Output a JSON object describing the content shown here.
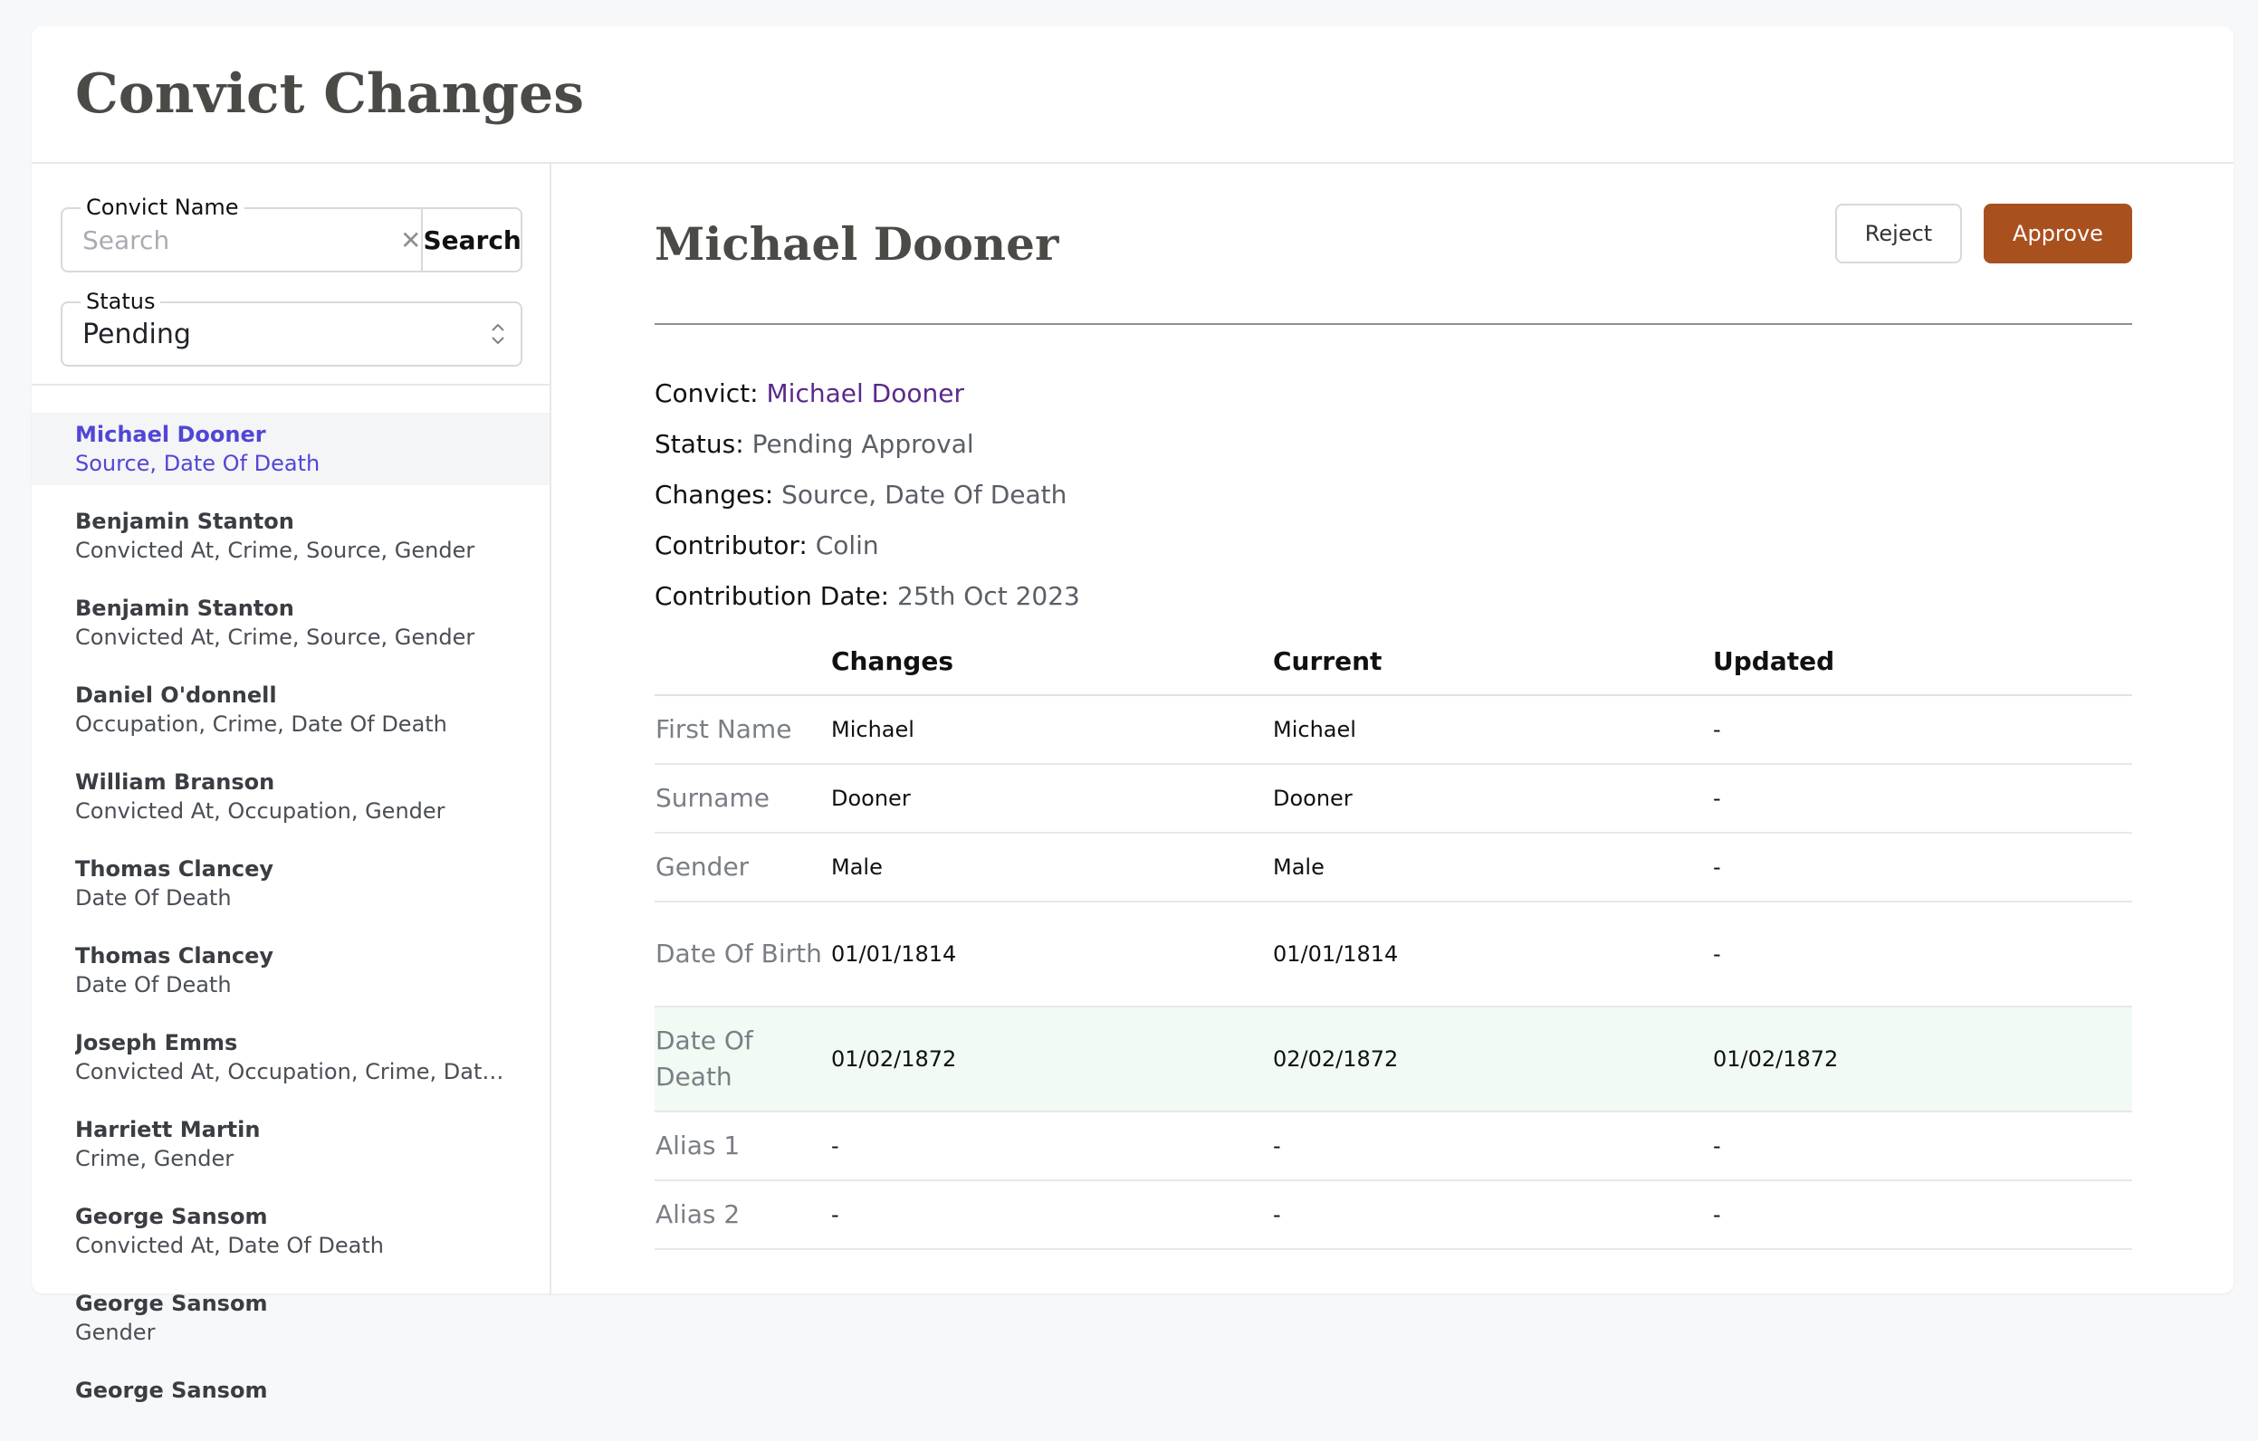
{
  "page": {
    "title": "Convict Changes"
  },
  "filters": {
    "name_legend": "Convict Name",
    "search_placeholder": "Search",
    "search_button": "Search",
    "status_legend": "Status",
    "status_value": "Pending"
  },
  "list": [
    {
      "name": "Michael Dooner",
      "changes": "Source, Date Of Death"
    },
    {
      "name": "Benjamin Stanton",
      "changes": "Convicted At, Crime, Source, Gender"
    },
    {
      "name": "Benjamin Stanton",
      "changes": "Convicted At, Crime, Source, Gender"
    },
    {
      "name": "Daniel O'donnell",
      "changes": "Occupation, Crime, Date Of Death"
    },
    {
      "name": "William Branson",
      "changes": "Convicted At, Occupation, Gender"
    },
    {
      "name": "Thomas Clancey",
      "changes": "Date Of Death"
    },
    {
      "name": "Thomas Clancey",
      "changes": "Date Of Death"
    },
    {
      "name": "Joseph Emms",
      "changes": "Convicted At, Occupation, Crime, Date Of..."
    },
    {
      "name": "Harriett Martin",
      "changes": "Crime, Gender"
    },
    {
      "name": "George Sansom",
      "changes": "Convicted At, Date Of Death"
    },
    {
      "name": "George Sansom",
      "changes": "Gender"
    },
    {
      "name": "George Sansom",
      "changes": ""
    }
  ],
  "detail": {
    "title": "Michael Dooner",
    "reject_label": "Reject",
    "approve_label": "Approve",
    "meta": {
      "convict_label": "Convict:",
      "convict_value": "Michael Dooner",
      "status_label": "Status:",
      "status_value": "Pending Approval",
      "changes_label": "Changes:",
      "changes_value": "Source, Date Of Death",
      "contributor_label": "Contributor:",
      "contributor_value": "Colin",
      "date_label": "Contribution Date:",
      "date_value": "25th Oct 2023"
    },
    "table": {
      "headers": [
        "",
        "Changes",
        "Current",
        "Updated"
      ],
      "rows": [
        {
          "label": "First Name",
          "changes": "Michael",
          "current": "Michael",
          "updated": "-"
        },
        {
          "label": "Surname",
          "changes": "Dooner",
          "current": "Dooner",
          "updated": "-"
        },
        {
          "label": "Gender",
          "changes": "Male",
          "current": "Male",
          "updated": "-"
        },
        {
          "label": "Date Of Birth",
          "changes": "01/01/1814",
          "current": "01/01/1814",
          "updated": "-"
        },
        {
          "label": "Date Of Death",
          "changes": "01/02/1872",
          "current": "02/02/1872",
          "updated": "01/02/1872"
        },
        {
          "label": "Alias 1",
          "changes": "-",
          "current": "-",
          "updated": "-"
        },
        {
          "label": "Alias 2",
          "changes": "-",
          "current": "-",
          "updated": "-"
        }
      ]
    }
  }
}
